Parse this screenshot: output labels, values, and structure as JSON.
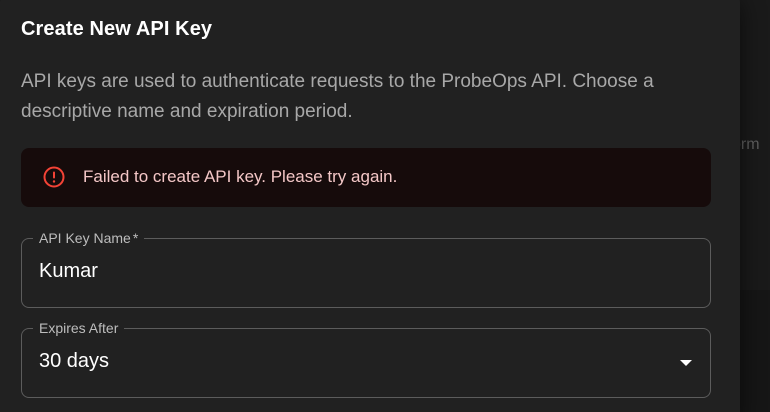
{
  "background": {
    "partial_text": "orm"
  },
  "dialog": {
    "title": "Create New API Key",
    "description": "API keys are used to authenticate requests to the ProbeOps API. Choose a descriptive name and expiration period.",
    "alert": {
      "message": "Failed to create API key. Please try again.",
      "icon": "error-circle-icon",
      "color": "#f44336"
    },
    "fields": {
      "name": {
        "label": "API Key Name",
        "required_mark": "*",
        "value": "Kumar"
      },
      "expires": {
        "label": "Expires After",
        "value": "30 days"
      }
    }
  }
}
